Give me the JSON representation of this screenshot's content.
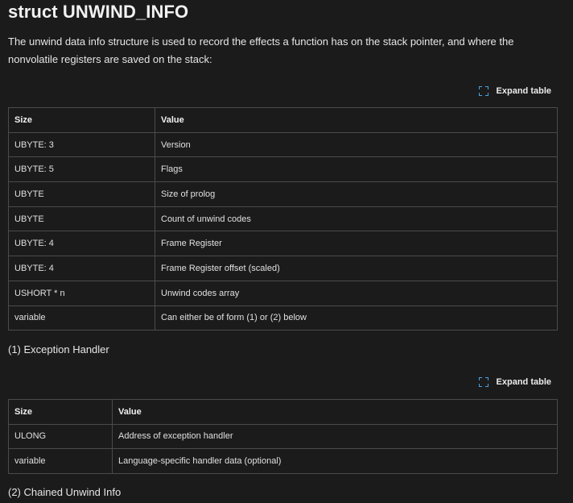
{
  "heading": "struct UNWIND_INFO",
  "intro": "The unwind data info structure is used to record the effects a function has on the stack pointer, and where the nonvolatile registers are saved on the stack:",
  "expand_label": "Expand table",
  "table1": {
    "headers": [
      "Size",
      "Value"
    ],
    "rows": [
      [
        "UBYTE: 3",
        "Version"
      ],
      [
        "UBYTE: 5",
        "Flags"
      ],
      [
        "UBYTE",
        "Size of prolog"
      ],
      [
        "UBYTE",
        "Count of unwind codes"
      ],
      [
        "UBYTE: 4",
        "Frame Register"
      ],
      [
        "UBYTE: 4",
        "Frame Register offset (scaled)"
      ],
      [
        "USHORT * n",
        "Unwind codes array"
      ],
      [
        "variable",
        "Can either be of form (1) or (2) below"
      ]
    ]
  },
  "caption1": "(1) Exception Handler",
  "table2": {
    "headers": [
      "Size",
      "Value"
    ],
    "rows": [
      [
        "ULONG",
        "Address of exception handler"
      ],
      [
        "variable",
        "Language-specific handler data (optional)"
      ]
    ]
  },
  "caption2": "(2) Chained Unwind Info",
  "icons": {
    "expand": "expand-icon"
  },
  "colors": {
    "background": "#1b1b1b",
    "accent": "#4aa3e6",
    "border": "#4b4b4b"
  }
}
